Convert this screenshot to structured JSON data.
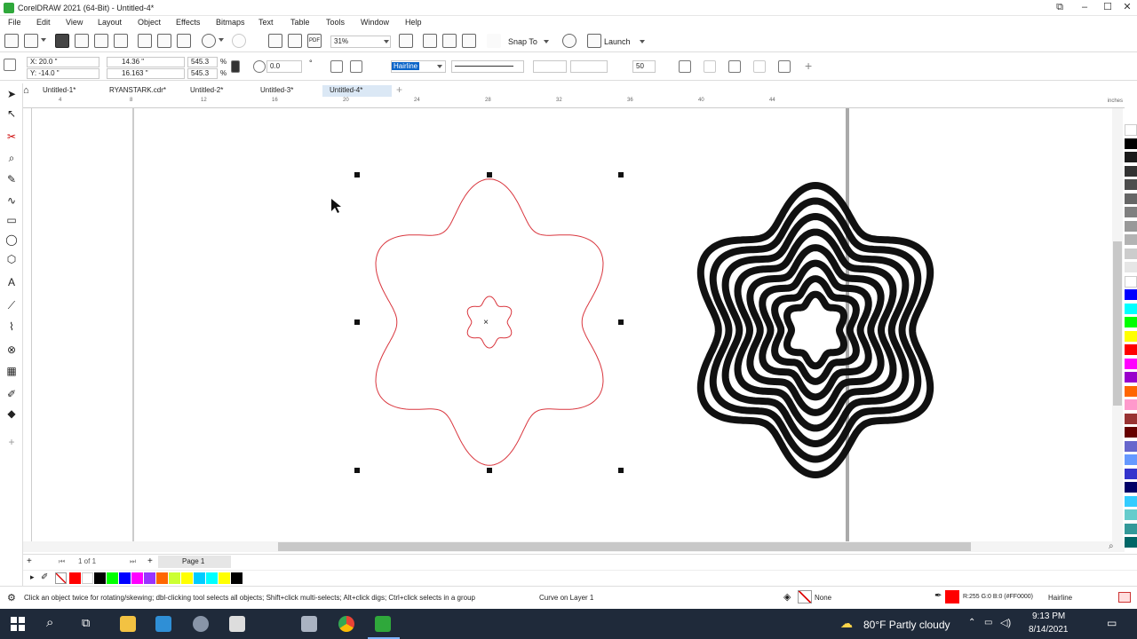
{
  "window": {
    "title": "CorelDRAW 2021 (64-Bit) - Untitled-4*"
  },
  "menu": [
    "File",
    "Edit",
    "View",
    "Layout",
    "Object",
    "Effects",
    "Bitmaps",
    "Text",
    "Table",
    "Tools",
    "Window",
    "Help"
  ],
  "toolbar": {
    "zoom": "31%",
    "snap_to": "Snap To",
    "launch": "Launch"
  },
  "propbar": {
    "x": "X: 20.0 \"",
    "y": "Y: -14.0 \"",
    "w": "14.36 \"",
    "h": "16.163 \"",
    "sx": "545.3",
    "sy": "545.3",
    "pct1": "%",
    "pct2": "%",
    "rot": "0.0",
    "outline": "Hairline",
    "smooth": "50"
  },
  "tabs": [
    "Untitled-1*",
    "RYANSTARK.cdr*",
    "Untitled-2*",
    "Untitled-3*",
    "Untitled-4*"
  ],
  "active_tab": "Untitled-4*",
  "ruler": {
    "units": "inches",
    "ticks": [
      "4",
      "8",
      "12",
      "16",
      "20",
      "24",
      "28",
      "32",
      "36",
      "40",
      "44"
    ]
  },
  "pager": {
    "count": "1 of 1",
    "page": "Page 1"
  },
  "status": {
    "hint": "Click an object twice for rotating/skewing; dbl-clicking tool selects all objects; Shift+click multi-selects; Alt+click digs; Ctrl+click selects in a group",
    "layer": "Curve on Layer 1",
    "fill": "None",
    "outline_color": "R:255 G:0 B:0 (#FF0000)",
    "outline_width": "Hairline"
  },
  "taskbar": {
    "weather": "80°F  Partly cloudy",
    "time": "9:13 PM",
    "date": "8/14/2021"
  },
  "colors": {
    "accent": "#2fa83b",
    "selection_outline": "#d9363e",
    "taskbar": "#1f2a3a"
  },
  "palette": [
    "#ffffff",
    "#000000",
    "#1a1a1a",
    "#333333",
    "#4d4d4d",
    "#666666",
    "#808080",
    "#999999",
    "#b3b3b3",
    "#cccccc",
    "#e6e6e6",
    "#ffffff",
    "#0000ff",
    "#00ffff",
    "#00ff00",
    "#ffff00",
    "#ff0000",
    "#ff00ff",
    "#9900cc",
    "#ff6600",
    "#ff99cc",
    "#993333",
    "#660000",
    "#6666cc",
    "#6699ff",
    "#3333cc",
    "#000066",
    "#33ccff",
    "#66cccc",
    "#339999",
    "#006666"
  ],
  "docpalette": [
    "#ff0000",
    "#ffffff",
    "#000000",
    "#00ff00",
    "#0000ff",
    "#ff00ff",
    "#9933ff",
    "#ff6600",
    "#ccff33",
    "#ffff00",
    "#00ccff",
    "#00ffff",
    "#ffff00",
    "#000000"
  ]
}
